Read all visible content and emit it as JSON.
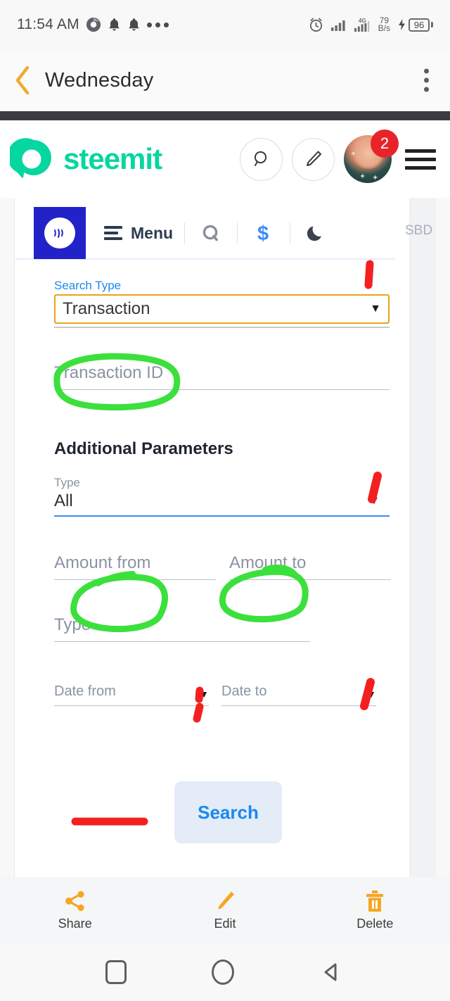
{
  "status_bar": {
    "time": "11:54 AM",
    "icons_left": [
      "chrome-icon",
      "bell-icon",
      "bell-icon",
      "overflow-dots-icon"
    ],
    "alarm_icon": "alarm-clock-icon",
    "signal_1": "signal-bars-icon",
    "signal_2": "signal-bars-4g-icon",
    "network_type": "4G",
    "net_speed_value": "79",
    "net_speed_unit": "B/s",
    "charging_icon": "charging-bolt-icon",
    "battery_level": "96"
  },
  "app_bar": {
    "back_icon": "back-chevron-icon",
    "title": "Wednesday",
    "overflow_icon": "kebab-menu-icon"
  },
  "steemit_header": {
    "logo_icon": "steemit-logo-icon",
    "brand": "steemit",
    "search_icon": "search-icon",
    "compose_icon": "pencil-edit-icon",
    "avatar": "user-avatar",
    "notification_count": "2",
    "menu_icon": "hamburger-menu-icon",
    "brand_color": "#06d6a0",
    "badge_color": "#e8242a"
  },
  "screenshot": {
    "toolbar": {
      "app_icon": "steem-logo-icon",
      "menu_icon": "menu-lines-icon",
      "menu_label": "Menu",
      "quest_icon": "quest-q-icon",
      "dollar_icon": "dollar-sign-icon",
      "theme_icon": "moon-dark-mode-icon",
      "currency_label": "SBD",
      "square_color": "#2222c9",
      "dollar_color": "#3d8bfd"
    },
    "form": {
      "search_type_label": "Search Type",
      "search_type_value": "Transaction",
      "search_type_caret": "chevron-down-icon",
      "transaction_id_placeholder": "Transaction ID",
      "additional_parameters_title": "Additional Parameters",
      "type_select_label": "Type",
      "type_select_value": "All",
      "type_select_caret": "chevron-down-icon",
      "amount_from_placeholder": "Amount from",
      "amount_to_placeholder": "Amount to",
      "type_placeholder": "Type",
      "date_from_placeholder": "Date from",
      "date_from_caret": "chevron-down-icon",
      "date_to_placeholder": "Date to",
      "date_to_caret": "chevron-down-icon",
      "search_button_label": "Search",
      "label_blue": "#1a88f0",
      "focus_border": "#e8a417"
    },
    "annotations": {
      "green_color": "#3ce03c",
      "red_color": "#f42020",
      "green_circles": [
        "transaction-id",
        "amount-from",
        "amount-to"
      ],
      "red_marks": [
        "near-search-type",
        "near-type-all",
        "near-date-from",
        "near-date-to",
        "under-search-button"
      ]
    }
  },
  "bottom_bar": {
    "items": [
      {
        "icon": "share-icon",
        "label": "Share"
      },
      {
        "icon": "pencil-edit-icon",
        "label": "Edit"
      },
      {
        "icon": "trash-delete-icon",
        "label": "Delete"
      }
    ],
    "accent_color": "#f5a623"
  },
  "nav_bar": {
    "recents_icon": "recents-square-icon",
    "home_icon": "home-circle-icon",
    "back_icon": "back-triangle-icon"
  }
}
